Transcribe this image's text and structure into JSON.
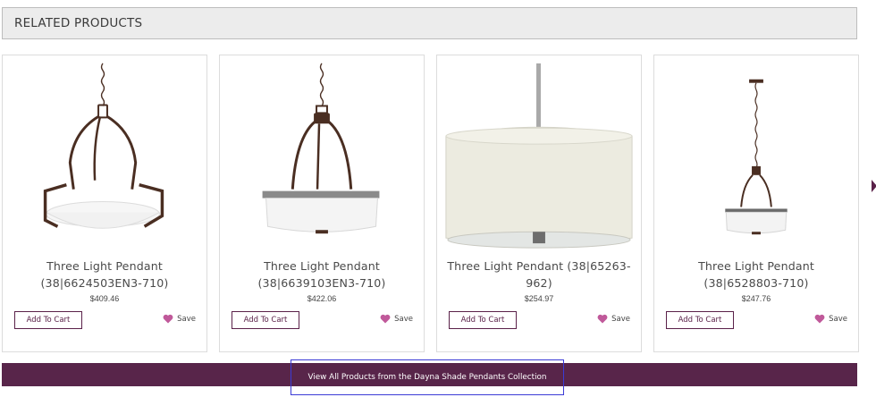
{
  "section": {
    "title": "RELATED PRODUCTS"
  },
  "products": [
    {
      "name": "Three Light Pendant (38|6624503EN3-710)",
      "price": "$409.46",
      "cart_label": "Add To Cart",
      "save_label": "Save",
      "image_icon": "pendant-lamp-bowl-bronze"
    },
    {
      "name": "Three Light Pendant (38|6639103EN3-710)",
      "price": "$422.06",
      "cart_label": "Add To Cart",
      "save_label": "Save",
      "image_icon": "pendant-lamp-drum-bronze"
    },
    {
      "name": "Three Light Pendant (38|65263-962)",
      "price": "$254.97",
      "cart_label": "Add To Cart",
      "save_label": "Save",
      "image_icon": "pendant-lamp-linen-drum"
    },
    {
      "name": "Three Light Pendant (38|6528803-710)",
      "price": "$247.76",
      "cart_label": "Add To Cart",
      "save_label": "Save",
      "image_icon": "pendant-lamp-small-bronze"
    }
  ],
  "view_all": {
    "label": "View All Products from the Dayna Shade Pendants Collection"
  },
  "colors": {
    "accent": "#58254a",
    "heart": "#c0599a",
    "header_bg": "#ececec",
    "bronze": "#4a2e22"
  },
  "icons": {
    "next": "chevron-right-icon",
    "save": "heart-icon"
  }
}
